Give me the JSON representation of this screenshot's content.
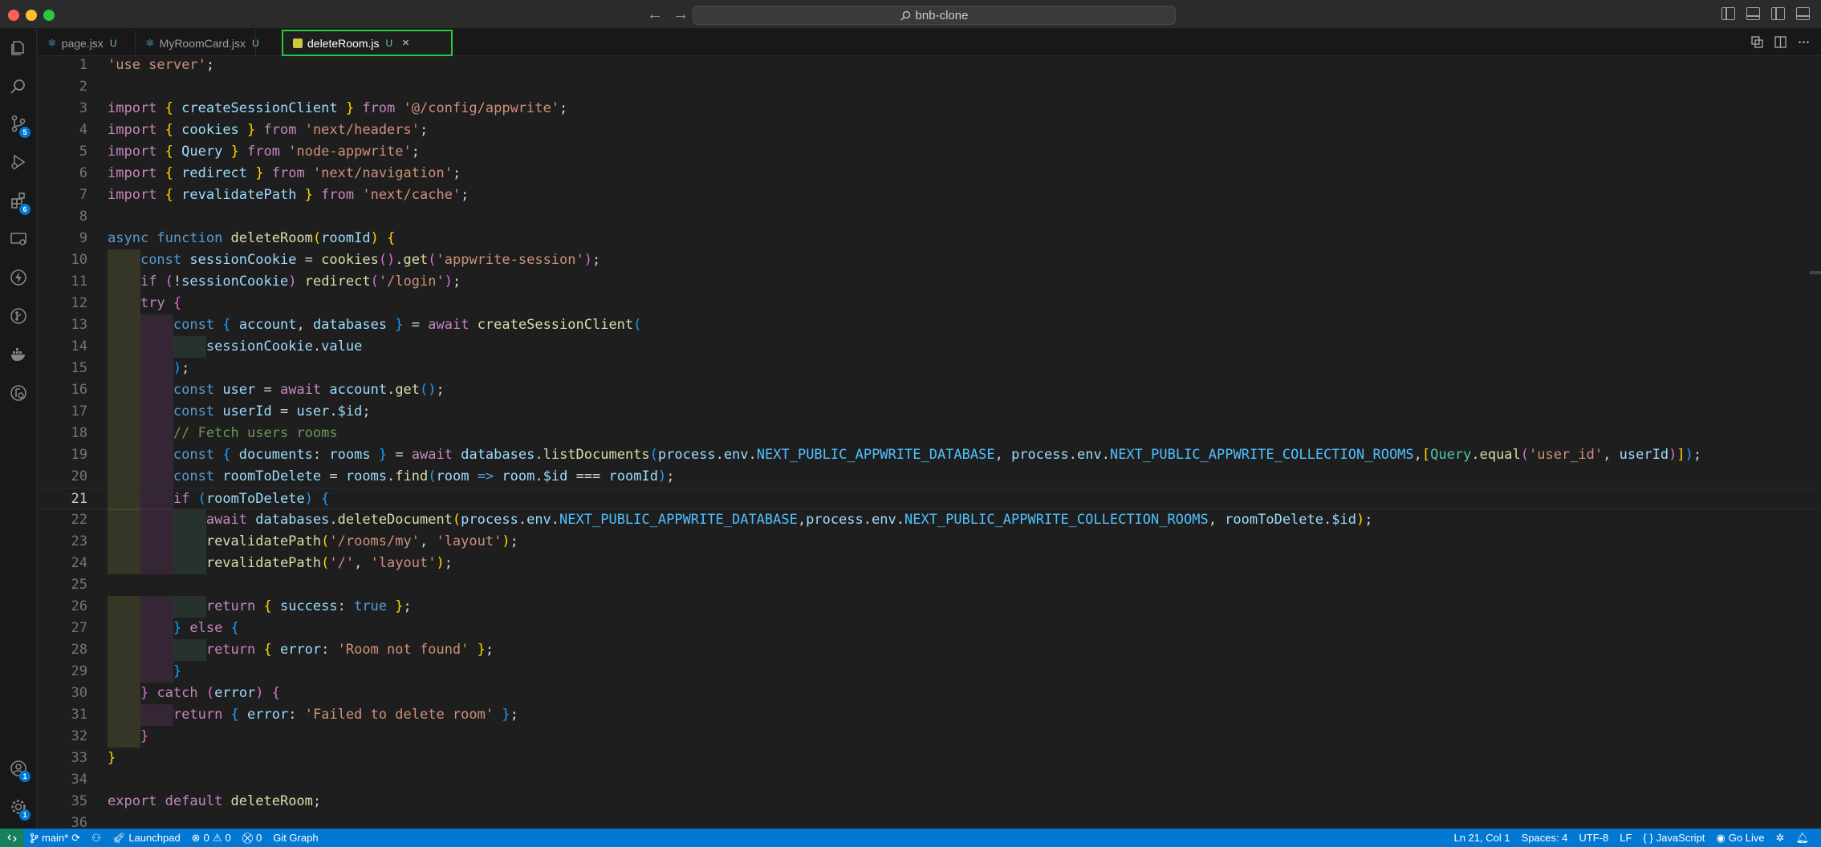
{
  "window": {
    "search_text": "bnb-clone"
  },
  "activity_bar": {
    "source_control_badge": "5",
    "extensions_badge": "6",
    "accounts_badge": "1",
    "settings_badge": "1"
  },
  "tabs": [
    {
      "label": "page.jsx",
      "status": "U",
      "active": false
    },
    {
      "label": "MyRoomCard.jsx",
      "status": "U",
      "active": false
    },
    {
      "label": "deleteRoom.js",
      "status": "U",
      "active": true
    }
  ],
  "tab_close_glyph": "×",
  "editor": {
    "current_line": 21,
    "lines": [
      [
        [
          "'use server'",
          "st"
        ],
        [
          ";",
          "pl"
        ]
      ],
      [],
      [
        [
          "import ",
          "kw"
        ],
        [
          "{ ",
          "br1"
        ],
        [
          "createSessionClient ",
          "va"
        ],
        [
          "} ",
          "br1"
        ],
        [
          "from ",
          "kw"
        ],
        [
          "'@/config/appwrite'",
          "st"
        ],
        [
          ";",
          "pl"
        ]
      ],
      [
        [
          "import ",
          "kw"
        ],
        [
          "{ ",
          "br1"
        ],
        [
          "cookies ",
          "va"
        ],
        [
          "} ",
          "br1"
        ],
        [
          "from ",
          "kw"
        ],
        [
          "'next/headers'",
          "st"
        ],
        [
          ";",
          "pl"
        ]
      ],
      [
        [
          "import ",
          "kw"
        ],
        [
          "{ ",
          "br1"
        ],
        [
          "Query ",
          "va"
        ],
        [
          "} ",
          "br1"
        ],
        [
          "from ",
          "kw"
        ],
        [
          "'node-appwrite'",
          "st"
        ],
        [
          ";",
          "pl"
        ]
      ],
      [
        [
          "import ",
          "kw"
        ],
        [
          "{ ",
          "br1"
        ],
        [
          "redirect ",
          "va"
        ],
        [
          "} ",
          "br1"
        ],
        [
          "from ",
          "kw"
        ],
        [
          "'next/navigation'",
          "st"
        ],
        [
          ";",
          "pl"
        ]
      ],
      [
        [
          "import ",
          "kw"
        ],
        [
          "{ ",
          "br1"
        ],
        [
          "revalidatePath ",
          "va"
        ],
        [
          "} ",
          "br1"
        ],
        [
          "from ",
          "kw"
        ],
        [
          "'next/cache'",
          "st"
        ],
        [
          ";",
          "pl"
        ]
      ],
      [],
      [
        [
          "async ",
          "bk"
        ],
        [
          "function ",
          "bk"
        ],
        [
          "deleteRoom",
          "fn"
        ],
        [
          "(",
          "br1"
        ],
        [
          "roomId",
          "va"
        ],
        [
          ") ",
          "br1"
        ],
        [
          "{",
          "br1"
        ]
      ],
      [
        [
          "    ",
          "pl"
        ],
        [
          "const ",
          "bk"
        ],
        [
          "sessionCookie ",
          "va"
        ],
        [
          "= ",
          "pl"
        ],
        [
          "cookies",
          "fn"
        ],
        [
          "()",
          "br2"
        ],
        [
          ".",
          "pl"
        ],
        [
          "get",
          "fn"
        ],
        [
          "(",
          "br2"
        ],
        [
          "'appwrite-session'",
          "st"
        ],
        [
          ")",
          "br2"
        ],
        [
          ";",
          "pl"
        ]
      ],
      [
        [
          "    ",
          "pl"
        ],
        [
          "if ",
          "kw"
        ],
        [
          "(",
          "br2"
        ],
        [
          "!",
          "pl"
        ],
        [
          "sessionCookie",
          "va"
        ],
        [
          ") ",
          "br2"
        ],
        [
          "redirect",
          "fn"
        ],
        [
          "(",
          "br2"
        ],
        [
          "'/login'",
          "st"
        ],
        [
          ")",
          "br2"
        ],
        [
          ";",
          "pl"
        ]
      ],
      [
        [
          "    ",
          "pl"
        ],
        [
          "try ",
          "kw"
        ],
        [
          "{",
          "br2"
        ]
      ],
      [
        [
          "        ",
          "pl"
        ],
        [
          "const ",
          "bk"
        ],
        [
          "{ ",
          "br3"
        ],
        [
          "account",
          "va"
        ],
        [
          ", ",
          "pl"
        ],
        [
          "databases ",
          "va"
        ],
        [
          "} ",
          "br3"
        ],
        [
          "= ",
          "pl"
        ],
        [
          "await ",
          "kw"
        ],
        [
          "createSessionClient",
          "fn"
        ],
        [
          "(",
          "br3"
        ]
      ],
      [
        [
          "            ",
          "pl"
        ],
        [
          "sessionCookie",
          "va"
        ],
        [
          ".",
          "pl"
        ],
        [
          "value",
          "va"
        ]
      ],
      [
        [
          "        ",
          "pl"
        ],
        [
          ")",
          "br3"
        ],
        [
          ";",
          "pl"
        ]
      ],
      [
        [
          "        ",
          "pl"
        ],
        [
          "const ",
          "bk"
        ],
        [
          "user ",
          "va"
        ],
        [
          "= ",
          "pl"
        ],
        [
          "await ",
          "kw"
        ],
        [
          "account",
          "va"
        ],
        [
          ".",
          "pl"
        ],
        [
          "get",
          "fn"
        ],
        [
          "()",
          "br3"
        ],
        [
          ";",
          "pl"
        ]
      ],
      [
        [
          "        ",
          "pl"
        ],
        [
          "const ",
          "bk"
        ],
        [
          "userId ",
          "va"
        ],
        [
          "= ",
          "pl"
        ],
        [
          "user",
          "va"
        ],
        [
          ".",
          "pl"
        ],
        [
          "$id",
          "va"
        ],
        [
          ";",
          "pl"
        ]
      ],
      [
        [
          "        ",
          "pl"
        ],
        [
          "// Fetch users rooms",
          "cm"
        ]
      ],
      [
        [
          "        ",
          "pl"
        ],
        [
          "const ",
          "bk"
        ],
        [
          "{ ",
          "br3"
        ],
        [
          "documents",
          "va"
        ],
        [
          ": ",
          "pl"
        ],
        [
          "rooms ",
          "va"
        ],
        [
          "} ",
          "br3"
        ],
        [
          "= ",
          "pl"
        ],
        [
          "await ",
          "kw"
        ],
        [
          "databases",
          "va"
        ],
        [
          ".",
          "pl"
        ],
        [
          "listDocuments",
          "fn"
        ],
        [
          "(",
          "br3"
        ],
        [
          "process",
          "va"
        ],
        [
          ".",
          "pl"
        ],
        [
          "env",
          "va"
        ],
        [
          ".",
          "pl"
        ],
        [
          "NEXT_PUBLIC_APPWRITE_DATABASE",
          "co"
        ],
        [
          ", ",
          "pl"
        ],
        [
          "process",
          "va"
        ],
        [
          ".",
          "pl"
        ],
        [
          "env",
          "va"
        ],
        [
          ".",
          "pl"
        ],
        [
          "NEXT_PUBLIC_APPWRITE_COLLECTION_ROOMS",
          "co"
        ],
        [
          ",",
          "pl"
        ],
        [
          "[",
          "br1"
        ],
        [
          "Query",
          "cl"
        ],
        [
          ".",
          "pl"
        ],
        [
          "equal",
          "fn"
        ],
        [
          "(",
          "br2"
        ],
        [
          "'user_id'",
          "st"
        ],
        [
          ", ",
          "pl"
        ],
        [
          "userId",
          "va"
        ],
        [
          ")",
          "br2"
        ],
        [
          "]",
          "br1"
        ],
        [
          ")",
          "br3"
        ],
        [
          ";",
          "pl"
        ]
      ],
      [
        [
          "        ",
          "pl"
        ],
        [
          "const ",
          "bk"
        ],
        [
          "roomToDelete ",
          "va"
        ],
        [
          "= ",
          "pl"
        ],
        [
          "rooms",
          "va"
        ],
        [
          ".",
          "pl"
        ],
        [
          "find",
          "fn"
        ],
        [
          "(",
          "br3"
        ],
        [
          "room ",
          "va"
        ],
        [
          "=> ",
          "bk"
        ],
        [
          "room",
          "va"
        ],
        [
          ".",
          "pl"
        ],
        [
          "$id ",
          "va"
        ],
        [
          "=== ",
          "pl"
        ],
        [
          "roomId",
          "va"
        ],
        [
          ")",
          "br3"
        ],
        [
          ";",
          "pl"
        ]
      ],
      [
        [
          "        ",
          "pl"
        ],
        [
          "if ",
          "kw"
        ],
        [
          "(",
          "br3"
        ],
        [
          "roomToDelete",
          "va"
        ],
        [
          ") ",
          "br3"
        ],
        [
          "{",
          "br3"
        ]
      ],
      [
        [
          "            ",
          "pl"
        ],
        [
          "await ",
          "kw"
        ],
        [
          "databases",
          "va"
        ],
        [
          ".",
          "pl"
        ],
        [
          "deleteDocument",
          "fn"
        ],
        [
          "(",
          "br1"
        ],
        [
          "process",
          "va"
        ],
        [
          ".",
          "pl"
        ],
        [
          "env",
          "va"
        ],
        [
          ".",
          "pl"
        ],
        [
          "NEXT_PUBLIC_APPWRITE_DATABASE",
          "co"
        ],
        [
          ",",
          "pl"
        ],
        [
          "process",
          "va"
        ],
        [
          ".",
          "pl"
        ],
        [
          "env",
          "va"
        ],
        [
          ".",
          "pl"
        ],
        [
          "NEXT_PUBLIC_APPWRITE_COLLECTION_ROOMS",
          "co"
        ],
        [
          ", ",
          "pl"
        ],
        [
          "roomToDelete",
          "va"
        ],
        [
          ".",
          "pl"
        ],
        [
          "$id",
          "va"
        ],
        [
          ")",
          "br1"
        ],
        [
          ";",
          "pl"
        ]
      ],
      [
        [
          "            ",
          "pl"
        ],
        [
          "revalidatePath",
          "fn"
        ],
        [
          "(",
          "br1"
        ],
        [
          "'/rooms/my'",
          "st"
        ],
        [
          ", ",
          "pl"
        ],
        [
          "'layout'",
          "st"
        ],
        [
          ")",
          "br1"
        ],
        [
          ";",
          "pl"
        ]
      ],
      [
        [
          "            ",
          "pl"
        ],
        [
          "revalidatePath",
          "fn"
        ],
        [
          "(",
          "br1"
        ],
        [
          "'/'",
          "st"
        ],
        [
          ", ",
          "pl"
        ],
        [
          "'layout'",
          "st"
        ],
        [
          ")",
          "br1"
        ],
        [
          ";",
          "pl"
        ]
      ],
      [],
      [
        [
          "            ",
          "pl"
        ],
        [
          "return ",
          "kw"
        ],
        [
          "{ ",
          "br1"
        ],
        [
          "success",
          "va"
        ],
        [
          ": ",
          "pl"
        ],
        [
          "true ",
          "bk"
        ],
        [
          "}",
          "br1"
        ],
        [
          ";",
          "pl"
        ]
      ],
      [
        [
          "        ",
          "pl"
        ],
        [
          "} ",
          "br3"
        ],
        [
          "else ",
          "kw"
        ],
        [
          "{",
          "br3"
        ]
      ],
      [
        [
          "            ",
          "pl"
        ],
        [
          "return ",
          "kw"
        ],
        [
          "{ ",
          "br1"
        ],
        [
          "error",
          "va"
        ],
        [
          ": ",
          "pl"
        ],
        [
          "'Room not found' ",
          "st"
        ],
        [
          "}",
          "br1"
        ],
        [
          ";",
          "pl"
        ]
      ],
      [
        [
          "        ",
          "pl"
        ],
        [
          "}",
          "br3"
        ]
      ],
      [
        [
          "    ",
          "pl"
        ],
        [
          "} ",
          "br2"
        ],
        [
          "catch ",
          "kw"
        ],
        [
          "(",
          "br2"
        ],
        [
          "error",
          "va"
        ],
        [
          ") ",
          "br2"
        ],
        [
          "{",
          "br2"
        ]
      ],
      [
        [
          "        ",
          "pl"
        ],
        [
          "return ",
          "kw"
        ],
        [
          "{ ",
          "br3"
        ],
        [
          "error",
          "va"
        ],
        [
          ": ",
          "pl"
        ],
        [
          "'Failed to delete room' ",
          "st"
        ],
        [
          "}",
          "br3"
        ],
        [
          ";",
          "pl"
        ]
      ],
      [
        [
          "    ",
          "pl"
        ],
        [
          "}",
          "br2"
        ]
      ],
      [
        [
          "}",
          "br1"
        ]
      ],
      [],
      [
        [
          "export ",
          "kw"
        ],
        [
          "default ",
          "kw"
        ],
        [
          "deleteRoom",
          "fn"
        ],
        [
          ";",
          "pl"
        ]
      ],
      []
    ]
  },
  "statusbar": {
    "branch": "main*",
    "launchpad": "Launchpad",
    "errors": "0",
    "warnings": "0",
    "ports": "0",
    "git_graph": "Git Graph",
    "cursor_position": "Ln 21, Col 1",
    "indentation": "Spaces: 4",
    "encoding": "UTF-8",
    "eol": "LF",
    "language_mode": "JavaScript",
    "go_live": "Go Live"
  }
}
